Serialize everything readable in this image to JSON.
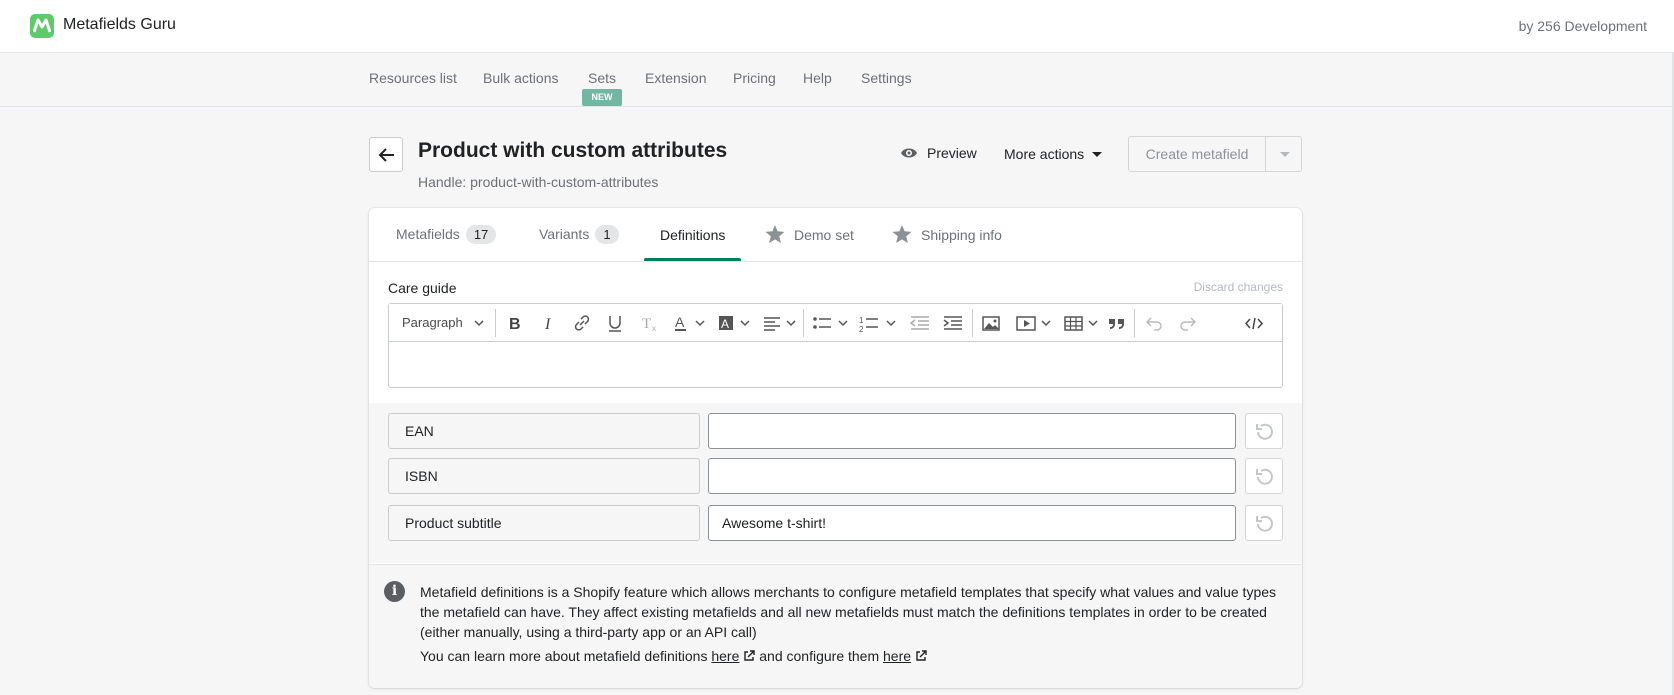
{
  "app": {
    "name": "Metafields Guru",
    "by": "by 256 Development",
    "brand_color": "#5fc96b"
  },
  "nav": {
    "items": [
      "Resources list",
      "Bulk actions",
      "Sets",
      "Extension",
      "Pricing",
      "Help",
      "Settings"
    ],
    "new_badge": "NEW"
  },
  "page": {
    "title": "Product with custom attributes",
    "handle": "Handle: product-with-custom-attributes",
    "preview_label": "Preview",
    "more_actions_label": "More actions",
    "create_label": "Create metafield"
  },
  "tabs": [
    {
      "label": "Metafields",
      "count": "17"
    },
    {
      "label": "Variants",
      "count": "1"
    },
    {
      "label": "Definitions",
      "active": true
    },
    {
      "label": "Demo set",
      "icon": "star-icon"
    },
    {
      "label": "Shipping info",
      "icon": "star-icon"
    }
  ],
  "care_guide": {
    "label": "Care guide",
    "discard": "Discard changes",
    "paragraph_select": "Paragraph",
    "content": ""
  },
  "fields": [
    {
      "key": "EAN",
      "value": ""
    },
    {
      "key": "ISBN",
      "value": ""
    },
    {
      "key": "Product subtitle",
      "value": "Awesome t-shirt!"
    }
  ],
  "info": {
    "text": "Metafield definitions is a Shopify feature which allows merchants to configure metafield templates that specify what values and value types the metafield can have. They affect existing metafields and all new metafields must match the definitions templates in order to be created (either manually, using a third-party app or an API call)",
    "learn_prefix": "You can learn more about metafield definitions",
    "link1": "here",
    "learn_middle": "and configure them",
    "link2": "here"
  },
  "colors": {
    "accent": "#008060",
    "badge": "#73b6a2"
  }
}
